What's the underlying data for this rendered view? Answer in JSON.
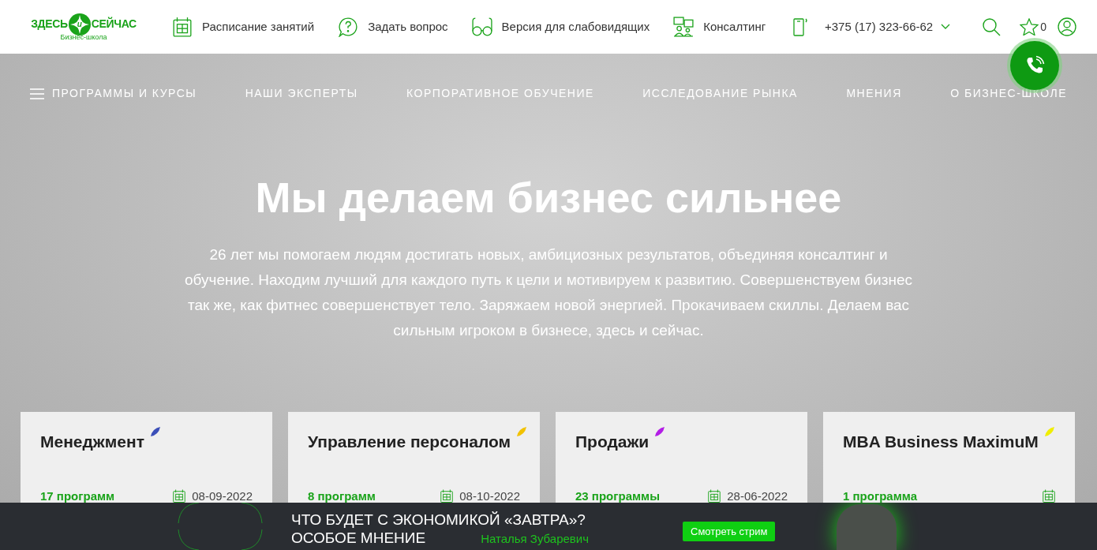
{
  "logo": {
    "left": "ЗДЕСЬ",
    "middle": "и",
    "right": "СЕЙЧАС",
    "subtitle": "Бизнес-школа"
  },
  "top_links": [
    {
      "kind": "schedule",
      "label": "Расписание занятий"
    },
    {
      "kind": "question",
      "label": "Задать вопрос"
    },
    {
      "kind": "glasses",
      "label": "Версия для слабовидящих"
    },
    {
      "kind": "consulting",
      "label": "Консалтинг"
    }
  ],
  "phone": "+375 (17) 323-66-62",
  "favorites_count": "0",
  "nav": [
    {
      "label": "ПРОГРАММЫ И КУРСЫ",
      "menu": true
    },
    {
      "label": "НАШИ ЭКСПЕРТЫ",
      "menu": false
    },
    {
      "label": "КОРПОРАТИВНОЕ ОБУЧЕНИЕ",
      "menu": false
    },
    {
      "label": "ИССЛЕДОВАНИЕ РЫНКА",
      "menu": false
    },
    {
      "label": "МНЕНИЯ",
      "menu": false
    },
    {
      "label": "О БИЗНЕС-ШКОЛЕ",
      "menu": false
    }
  ],
  "hero": {
    "title": "Мы делаем бизнес сильнее",
    "text": "26 лет мы помогаем людям достигать новых, амбициозных результатов, объединяя консалтинг и обучение. Находим лучший для каждого путь к цели и мотивируем к развитию. Совершенствуем бизнес так же, как фитнес совершенствует тело. Заряжаем новой энергией. Прокачиваем скиллы. Делаем вас сильным игроком в бизнесе, здесь и сейчас."
  },
  "cards": [
    {
      "title": "Менеджмент",
      "color": "#3b4fb8",
      "count": "17 программ",
      "date": "08-09-2022"
    },
    {
      "title": "Управление персоналом",
      "color": "#f2c200",
      "count": "8 программ",
      "date": "08-10-2022"
    },
    {
      "title": "Продажи",
      "color": "#b31ee6",
      "count": "23 программы",
      "date": "28-06-2022"
    },
    {
      "title": "MBA Business MaximuM",
      "color": "#f0ee00",
      "count": "1 программа"
    }
  ],
  "banner": {
    "headline_1": "ЧТО БУДЕТ С ЭКОНОМИКОЙ «ЗАВТРА»?",
    "headline_2": "ОСОБОЕ МНЕНИЕ",
    "speaker": "Наталья Зубаревич",
    "button": "Смотреть стрим"
  }
}
